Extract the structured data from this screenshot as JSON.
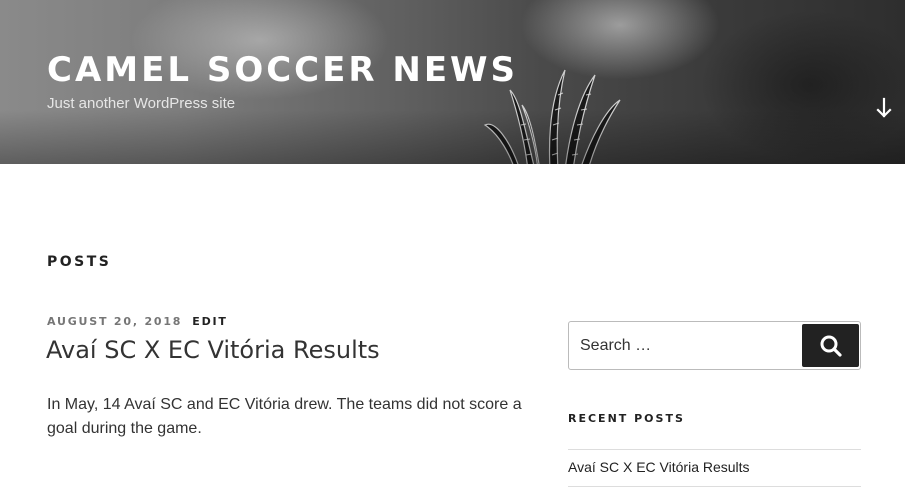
{
  "header": {
    "site_title": "CAMEL SOCCER NEWS",
    "site_description": "Just another WordPress site",
    "scroll_icon": "arrow-down-icon"
  },
  "main": {
    "page_title": "POSTS",
    "posts": [
      {
        "date": "AUGUST 20, 2018",
        "edit_label": "EDIT",
        "title": "Avaí SC X EC Vitória Results",
        "excerpt": "In May, 14 Avaí SC and EC Vitória drew. The teams did not score a goal during the game."
      }
    ]
  },
  "sidebar": {
    "search": {
      "placeholder": "Search …",
      "submit_icon": "search-icon"
    },
    "recent_posts": {
      "title": "RECENT POSTS",
      "items": [
        "Avaí SC X EC Vitória Results"
      ]
    }
  },
  "colors": {
    "text": "#222222",
    "meta": "#767676",
    "button_bg": "#222222",
    "header_text": "#ffffff"
  }
}
